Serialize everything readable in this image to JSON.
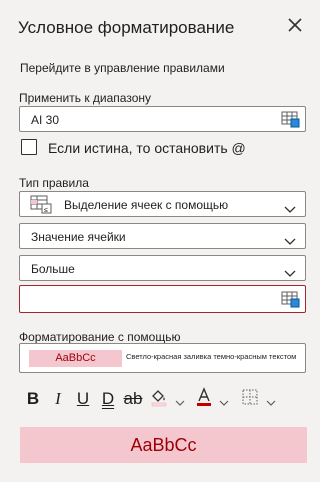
{
  "header": {
    "title": "Условное форматирование",
    "close_icon": "close-icon"
  },
  "manage_rules_link": "Перейдите в управление правилами",
  "apply_to": {
    "label": "Применить к диапазону",
    "value": "AI 30",
    "picker_icon": "range-select-icon"
  },
  "stop_if_true": {
    "label": "Если истина, то остановить @",
    "checked": false
  },
  "rule_type": {
    "label": "Тип правила",
    "selected": "Выделение ячеек с помощью",
    "icon": "highlight-cells-rule-icon"
  },
  "condition": {
    "operand_selected": "Значение ячейки",
    "operator_selected": "Больше",
    "value": "",
    "picker_icon": "range-select-icon"
  },
  "format_with": {
    "label": "Форматирование с помощью",
    "sample": "AaBbCc",
    "description": "Светло-красная заливка темно-красным текстом"
  },
  "toolbar": {
    "bold": "B",
    "italic": "I",
    "underline": "U",
    "double_underline": "D",
    "strikethrough": "ab",
    "fill_icon": "fill-color-icon",
    "font_color_icon": "font-color-icon",
    "borders_icon": "borders-icon"
  },
  "preview": {
    "text": "AaBbCc"
  },
  "colors": {
    "highlight_fill": "#f4c7ce",
    "highlight_text": "#9c0006",
    "error_border": "#a4262c",
    "font_color_bar": "#c00000",
    "fill_color_bar": "#ffd8de"
  }
}
